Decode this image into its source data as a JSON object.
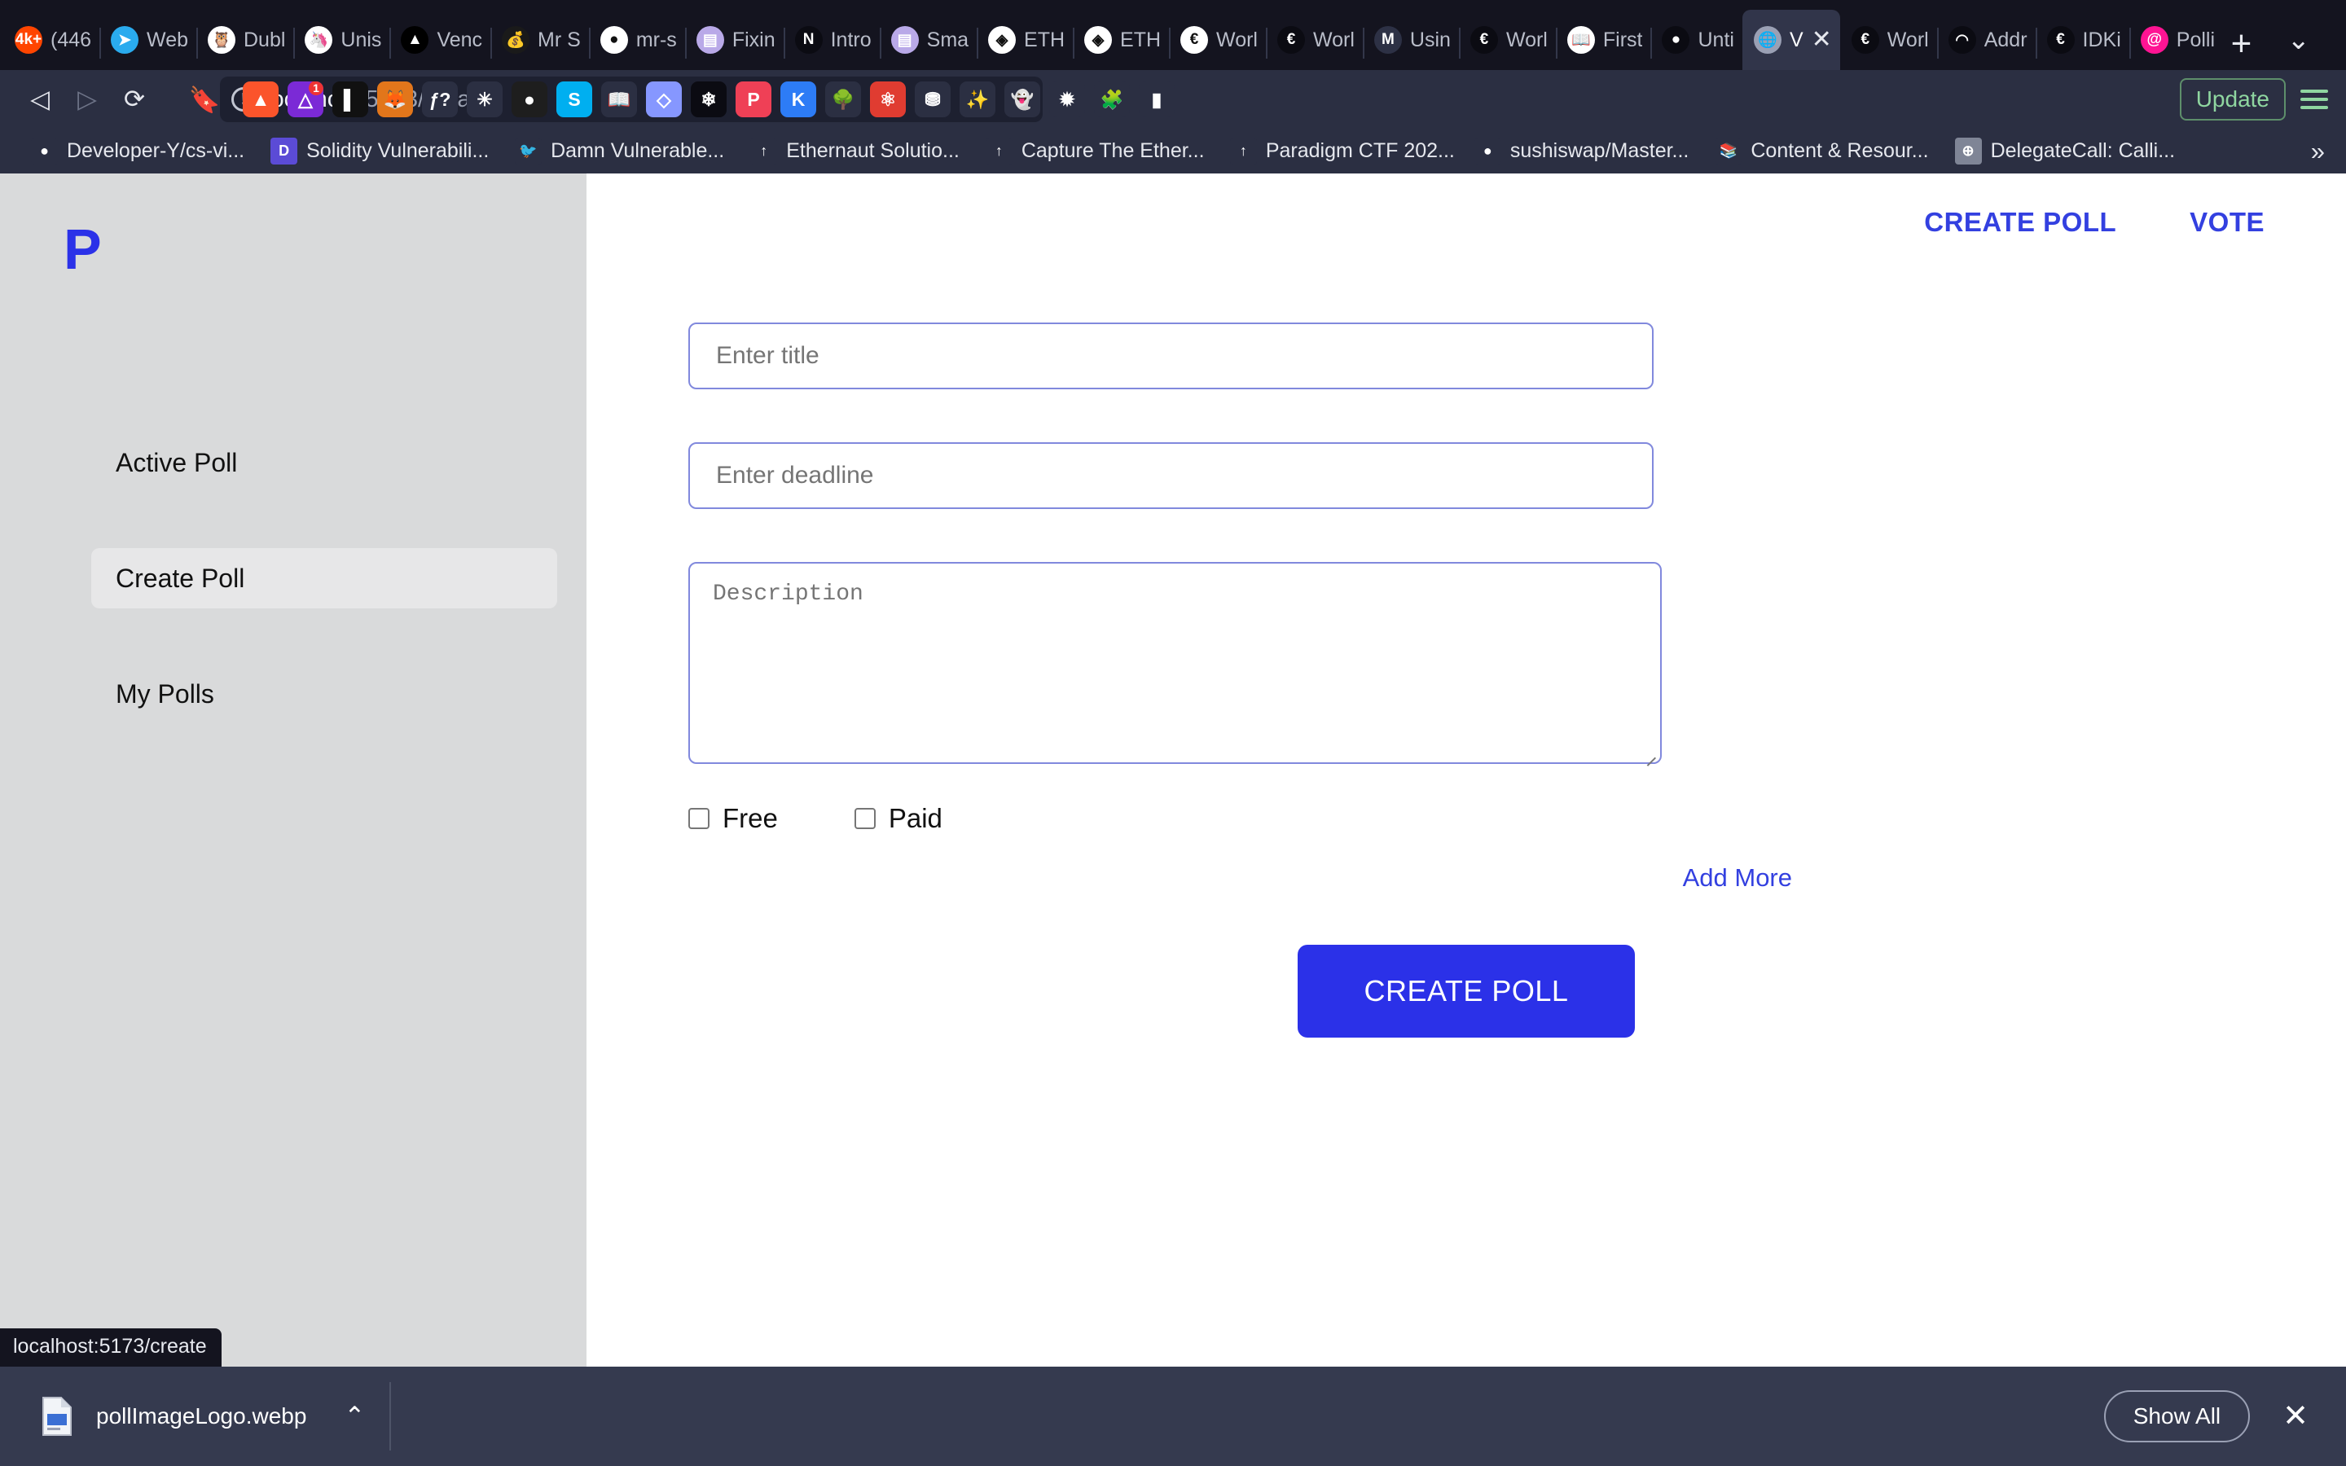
{
  "browser": {
    "tabs": [
      {
        "label": "(446",
        "favicon": "reddit-4k-icon",
        "color": "#ff4500",
        "glyph": "4k+"
      },
      {
        "label": "Web",
        "favicon": "telegram-icon",
        "color": "#2aabee",
        "glyph": "➤"
      },
      {
        "label": "Dubl",
        "favicon": "owl-icon",
        "color": "#ffffff",
        "glyph": "🦉"
      },
      {
        "label": "Unis",
        "favicon": "uniswap-unicorn-icon",
        "color": "#ffffff",
        "glyph": "🦄"
      },
      {
        "label": "Venc",
        "favicon": "vercel-triangle-icon",
        "color": "#000000",
        "glyph": "▲"
      },
      {
        "label": "Mr S",
        "favicon": "moneybag-icon",
        "color": "#1a1a1a",
        "glyph": "💰"
      },
      {
        "label": "mr-s",
        "favicon": "github-icon",
        "color": "#ffffff",
        "glyph": "●"
      },
      {
        "label": "Fixin",
        "favicon": "notion-page-icon",
        "color": "#b9a9e8",
        "glyph": "▤"
      },
      {
        "label": "Intro",
        "favicon": "notion-n-icon",
        "color": "#0b0b12",
        "glyph": "N"
      },
      {
        "label": "Sma",
        "favicon": "notion-page-icon",
        "color": "#b9a9e8",
        "glyph": "▤"
      },
      {
        "label": "ETH",
        "favicon": "ethereum-atom-icon",
        "color": "#ffffff",
        "glyph": "◈"
      },
      {
        "label": "ETH",
        "favicon": "ethereum-atom-icon",
        "color": "#ffffff",
        "glyph": "◈"
      },
      {
        "label": "Worl",
        "favicon": "euro-e-icon",
        "color": "#ffffff",
        "glyph": "€"
      },
      {
        "label": "Worl",
        "favicon": "euro-e-dark-icon",
        "color": "#0b0b12",
        "glyph": "€"
      },
      {
        "label": "Usin",
        "favicon": "medium-m-icon",
        "color": "#2d3145",
        "glyph": "M"
      },
      {
        "label": "Worl",
        "favicon": "euro-e-dark-icon",
        "color": "#0b0b12",
        "glyph": "€"
      },
      {
        "label": "First",
        "favicon": "book-icon",
        "color": "#ffffff",
        "glyph": "📖"
      },
      {
        "label": "Unti",
        "favicon": "figma-icon",
        "color": "#0b0b12",
        "glyph": "●"
      },
      {
        "label": "V",
        "favicon": "globe-icon",
        "color": "#9aa0b4",
        "glyph": "🌐",
        "active": true,
        "close": "✕"
      },
      {
        "label": "Worl",
        "favicon": "euro-e-dark-icon",
        "color": "#0b0b12",
        "glyph": "€"
      },
      {
        "label": "Addr",
        "favicon": "chart-dark-icon",
        "color": "#0b0b12",
        "glyph": "◠"
      },
      {
        "label": "IDKi",
        "favicon": "euro-e-dark-icon",
        "color": "#0b0b12",
        "glyph": "€"
      },
      {
        "label": "Polli",
        "favicon": "pink-spiral-icon",
        "color": "#ff1493",
        "glyph": "@"
      }
    ],
    "new_tab_label": "+",
    "tab_list_chevron": "⌄",
    "nav": {
      "back": "◁",
      "forward": "▷",
      "reload": "⟳",
      "bookmark": "🔖"
    },
    "url": {
      "info_glyph": "!",
      "host": "localhost",
      "path": ":5173/create",
      "full": "localhost:5173/create"
    },
    "extensions": [
      {
        "name": "brave-lion-icon",
        "color": "#fb542b",
        "glyph": "▲"
      },
      {
        "name": "brave-shield-icon",
        "color": "#7b2ad6",
        "glyph": "△",
        "badge": "1"
      },
      {
        "name": "phantom-split-icon",
        "color": "#111111",
        "glyph": "▌"
      },
      {
        "name": "metamask-fox-icon",
        "color": "#e2761b",
        "glyph": "🦊"
      },
      {
        "name": "f-question-icon",
        "color": "#2b2f42",
        "glyph": "ƒ?"
      },
      {
        "name": "asterisk-purple-icon",
        "color": "#2b2f42",
        "glyph": "✳"
      },
      {
        "name": "figma-icon",
        "color": "#1e1e1e",
        "glyph": "●"
      },
      {
        "name": "skype-icon",
        "color": "#00aff0",
        "glyph": "S"
      },
      {
        "name": "book-open-icon",
        "color": "#2b2f42",
        "glyph": "📖"
      },
      {
        "name": "rabby-wallet-icon",
        "color": "#8697ff",
        "glyph": "◇"
      },
      {
        "name": "snowflake-icon",
        "color": "#0b0b12",
        "glyph": "❄"
      },
      {
        "name": "pocket-icon",
        "color": "#ef4056",
        "glyph": "P"
      },
      {
        "name": "kaito-k-icon",
        "color": "#2d7cf6",
        "glyph": "K"
      },
      {
        "name": "html-tree-icon",
        "color": "#2b2f42",
        "glyph": "🌳"
      },
      {
        "name": "react-devtools-icon",
        "color": "#e03c31",
        "glyph": "⚛"
      },
      {
        "name": "ghost-grey-icon",
        "color": "#2b2f42",
        "glyph": "⛃"
      },
      {
        "name": "gemini-spark-icon",
        "color": "#2b2f42",
        "glyph": "✨"
      },
      {
        "name": "ghost-purple-icon",
        "color": "#2b2f42",
        "glyph": "👻"
      },
      {
        "name": "star-burst-icon",
        "color": "#2b2f42",
        "glyph": "✹"
      },
      {
        "name": "puzzle-extensions-icon",
        "color": "#2b2f42",
        "glyph": "🧩"
      },
      {
        "name": "sidebar-panel-icon",
        "color": "#2b2f42",
        "glyph": "▮"
      }
    ],
    "update_label": "Update",
    "bookmarks": [
      {
        "label": "Developer-Y/cs-vi...",
        "icon": "github-icon",
        "color": "#2b2f42",
        "glyph": "●"
      },
      {
        "label": "Solidity Vulnerabili...",
        "icon": "d-circle-icon",
        "color": "#5b4bd6",
        "glyph": "D"
      },
      {
        "label": "Damn Vulnerable...",
        "icon": "twitter-bird-icon",
        "color": "#2b2f42",
        "glyph": "🐦"
      },
      {
        "label": "Ethernaut Solutio...",
        "icon": "openzeppelin-icon",
        "color": "#2b2f42",
        "glyph": "↑"
      },
      {
        "label": "Capture The Ether...",
        "icon": "openzeppelin-icon",
        "color": "#2b2f42",
        "glyph": "↑"
      },
      {
        "label": "Paradigm CTF 202...",
        "icon": "openzeppelin-icon",
        "color": "#2b2f42",
        "glyph": "↑"
      },
      {
        "label": "sushiswap/Master...",
        "icon": "github-icon",
        "color": "#2b2f42",
        "glyph": "●"
      },
      {
        "label": "Content & Resour...",
        "icon": "books-icon",
        "color": "#2b2f42",
        "glyph": "📚"
      },
      {
        "label": "DelegateCall: Calli...",
        "icon": "globe-grey-icon",
        "color": "#7f8596",
        "glyph": "⊕"
      }
    ],
    "bookmarks_overflow": "»"
  },
  "page": {
    "sidebar": {
      "logo": "P",
      "items": [
        {
          "label": "Active Poll",
          "active": false
        },
        {
          "label": "Create Poll",
          "active": true
        },
        {
          "label": "My Polls",
          "active": false
        }
      ]
    },
    "topnav": [
      {
        "label": "CREATE POLL"
      },
      {
        "label": "VOTE"
      }
    ],
    "form": {
      "title_placeholder": "Enter title",
      "title_value": "",
      "deadline_placeholder": "Enter deadline",
      "deadline_value": "",
      "description_placeholder": "Description",
      "description_value": "",
      "options": [
        {
          "label": "Free",
          "checked": false
        },
        {
          "label": "Paid",
          "checked": false
        }
      ],
      "add_more_label": "Add More",
      "submit_label": "CREATE POLL"
    },
    "status_tooltip": "localhost:5173/create"
  },
  "downloads": {
    "file_name": "pollImageLogo.webp",
    "caret": "⌃",
    "show_all_label": "Show All",
    "close": "✕"
  },
  "colors": {
    "accent_blue": "#2b31e8",
    "link_blue": "#3340e0",
    "sidebar_bg": "#d9dadb",
    "chrome_bg": "#2b2f42",
    "tabstrip_bg": "#14141f",
    "downloads_bg": "#353a4f",
    "field_border": "#8189dd"
  }
}
